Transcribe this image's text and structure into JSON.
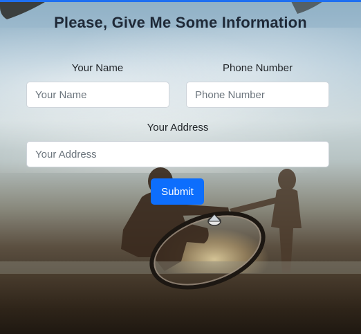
{
  "form": {
    "title": "Please, Give Me Some Information",
    "name_label": "Your Name",
    "name_placeholder": "Your Name",
    "phone_label": "Phone Number",
    "phone_placeholder": "Phone Number",
    "address_label": "Your Address",
    "address_placeholder": "Your Address",
    "submit_label": "Submit"
  },
  "colors": {
    "accent": "#0d6efd",
    "top_bar": "#1e6ff1"
  }
}
